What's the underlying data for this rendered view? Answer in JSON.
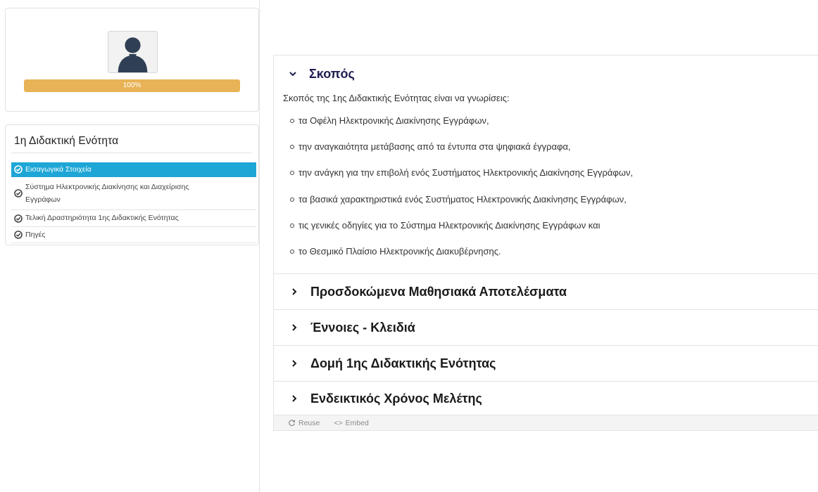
{
  "profile": {
    "avatar_icon": "user-silhouette-icon",
    "progress_value": 100,
    "progress_label": "100%",
    "progress_color": "#e8b356"
  },
  "unit": {
    "title": "1η Διδακτική Ενότητα",
    "items": [
      {
        "label": "Εισαγωγικά Στοιχεία",
        "icon": "check-circle-icon",
        "active": true
      },
      {
        "label_line1": "Σύστημα Ηλεκτρονικής Διακίνησης και Διαχείρισης",
        "label_line2": "Εγγράφων",
        "icon": "check-circle-icon",
        "active": false
      },
      {
        "label": "Τελική Δραστηριότητα 1ης Διδακτικής Ενότητας",
        "icon": "check-circle-icon",
        "active": false
      },
      {
        "label": "Πηγές",
        "icon": "check-circle-icon",
        "active": false
      }
    ],
    "active_color": "#1da6d6"
  },
  "accordion": {
    "sections": [
      {
        "title": "Σκοπός",
        "open": true,
        "intro": "Σκοπός της 1ης  Διδακτικής Ενότητας  είναι να γνωρίσεις:",
        "bullets": [
          "τα Οφέλη Ηλεκτρονικής Διακίνησης Εγγράφων,",
          "την αναγκαιότητα μετάβασης από τα έντυπα στα ψηφιακά έγγραφα,",
          "την ανάγκη για την επιβολή ενός Συστήματος Ηλεκτρονικής Διακίνησης Εγγράφων,",
          "τα βασικά χαρακτηριστικά ενός Συστήματος Ηλεκτρονικής Διακίνησης Εγγράφων,",
          "τις γενικές οδηγίες για το Σύστημα Ηλεκτρονικής Διακίνησης Εγγράφων και",
          "το Θεσμικό Πλαίσιο Ηλεκτρονικής Διακυβέρνησης."
        ]
      },
      {
        "title": "Προσδοκώμενα Μαθησιακά Αποτελέσματα",
        "open": false
      },
      {
        "title": "Έννοιες - Κλειδιά",
        "open": false
      },
      {
        "title": "Δομή 1ης Διδακτικής Ενότητας",
        "open": false
      },
      {
        "title": "Ενδεικτικός Χρόνος Μελέτης",
        "open": false
      }
    ]
  },
  "footer": {
    "reuse_label": "Reuse",
    "reuse_icon": "reuse-arrows-icon",
    "embed_label": "Embed",
    "embed_icon": "embed-code-icon"
  }
}
